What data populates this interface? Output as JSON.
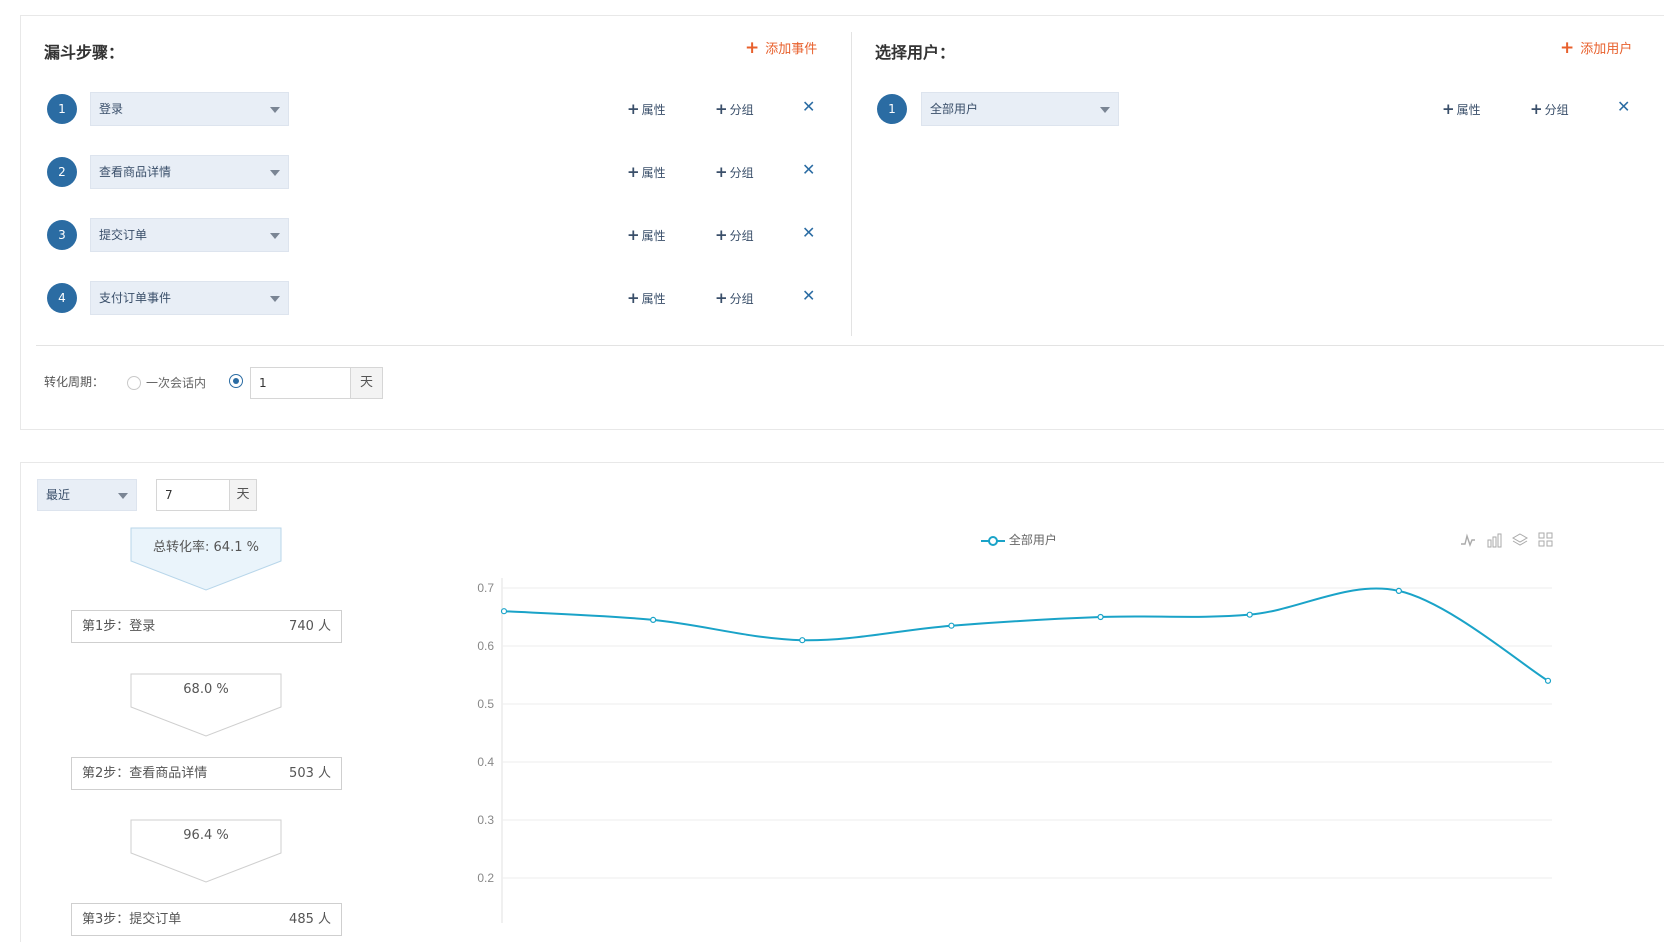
{
  "funnel": {
    "title": "漏斗步骤：",
    "add_label": "添加事件",
    "steps": [
      {
        "num": "1",
        "event": "登录"
      },
      {
        "num": "2",
        "event": "查看商品详情"
      },
      {
        "num": "3",
        "event": "提交订单"
      },
      {
        "num": "4",
        "event": "支付订单事件"
      }
    ],
    "attr_label": "属性",
    "group_label": "分组"
  },
  "users": {
    "title": "选择用户：",
    "add_label": "添加用户",
    "rows": [
      {
        "num": "1",
        "group": "全部用户"
      }
    ],
    "attr_label": "属性",
    "group_label": "分组"
  },
  "period": {
    "label": "转化周期：",
    "option_session": "一次会话内",
    "days_value": "1",
    "unit": "天"
  },
  "range": {
    "select_label": "最近",
    "days_value": "7",
    "unit": "天"
  },
  "funnel_result": {
    "total_rate": "总转化率: 64.1 %",
    "steps": [
      {
        "label": "第1步：登录",
        "count": "740 人"
      },
      {
        "label": "第2步：查看商品详情",
        "count": "503 人"
      },
      {
        "label": "第3步：提交订单",
        "count": "485 人"
      }
    ],
    "rates": [
      "68.0 %",
      "96.4 %"
    ]
  },
  "chart_data": {
    "type": "line",
    "series": [
      {
        "name": "全部用户",
        "values": [
          0.66,
          0.645,
          0.61,
          0.635,
          0.65,
          0.654,
          0.695,
          0.54
        ]
      }
    ],
    "yticks": [
      "0.7",
      "0.6",
      "0.5",
      "0.4",
      "0.3",
      "0.2"
    ],
    "ylim": [
      0.2,
      0.7
    ],
    "grid": true,
    "legend_position": "top-center",
    "line_color": "#1aa3c8"
  }
}
